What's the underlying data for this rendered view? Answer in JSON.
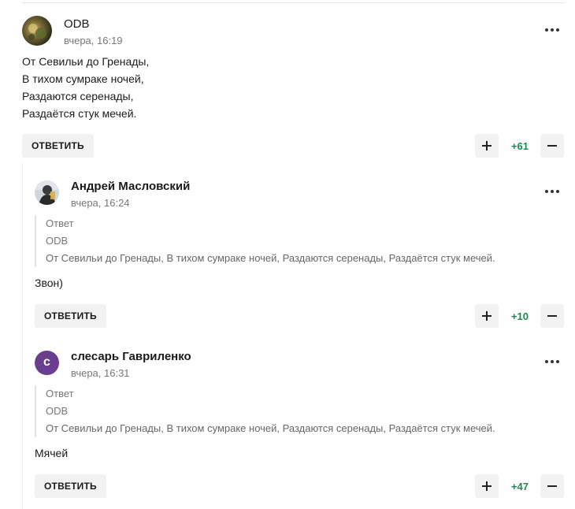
{
  "comments": [
    {
      "author": "ODB",
      "time": "вчера, 16:19",
      "body_lines": [
        "От Севильи до Гренады,",
        "В тихом сумраке ночей,",
        "Раздаются серенады,",
        "Раздаётся стук мечей."
      ],
      "reply_label": "ОТВЕТИТЬ",
      "score": "+61"
    },
    {
      "author": "Андрей Масловский",
      "time": "вчера, 16:24",
      "quote": {
        "label": "Ответ",
        "author": "ODB",
        "text": "От Севильи до Гренады, В тихом сумраке ночей, Раздаются серенады, Раздаётся стук мечей."
      },
      "body": "Звон)",
      "reply_label": "ОТВЕТИТЬ",
      "score": "+10"
    },
    {
      "author": "слесарь Гавриленко",
      "avatar_letter": "с",
      "time": "вчера, 16:31",
      "quote": {
        "label": "Ответ",
        "author": "ODB",
        "text": "От Севильи до Гренады, В тихом сумраке ночей, Раздаются серенады, Раздаётся стук мечей."
      },
      "body": "Мячей",
      "reply_label": "ОТВЕТИТЬ",
      "score": "+47"
    }
  ],
  "colors": {
    "score_green": "#1f8a4c",
    "avatar_purple": "#6a3d8f",
    "button_bg": "#f2f2f2"
  },
  "icons": [
    "more-icon",
    "plus-icon",
    "minus-icon"
  ]
}
